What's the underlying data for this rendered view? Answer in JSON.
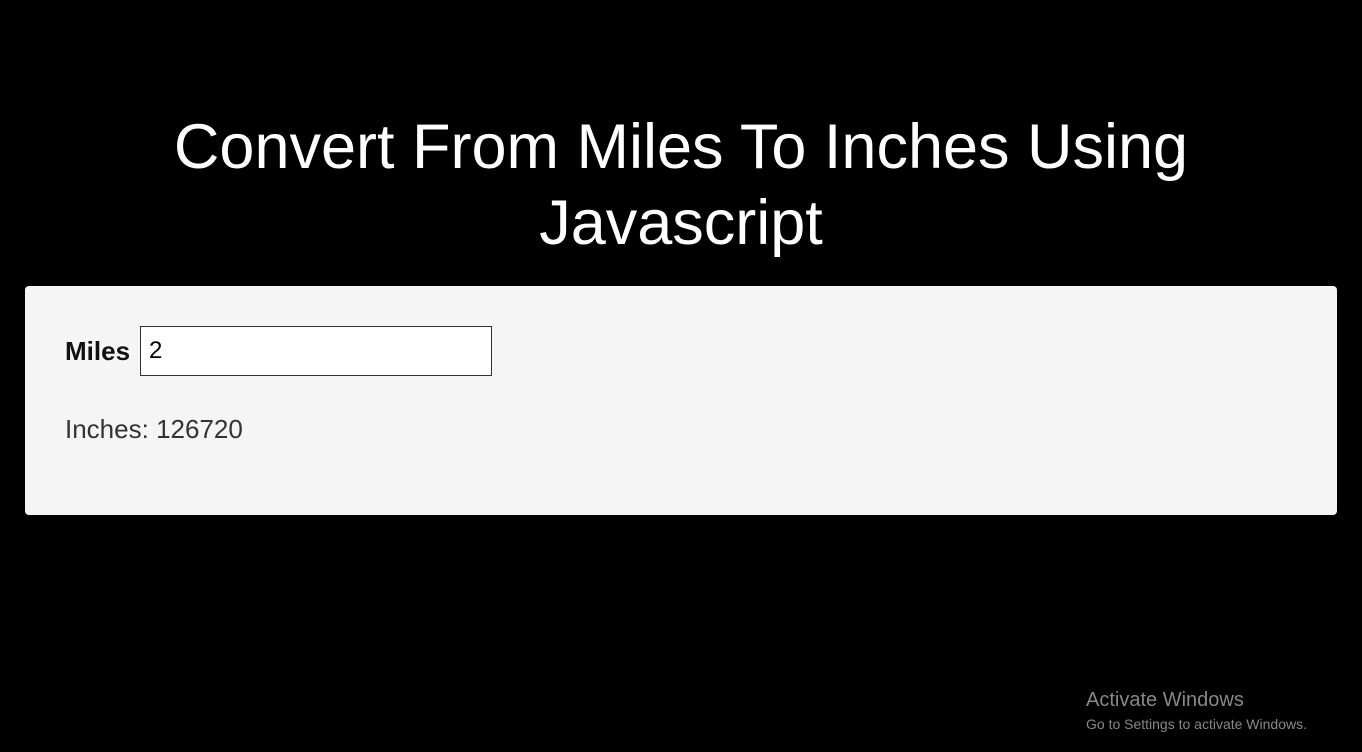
{
  "heading": "Convert From Miles To Inches Using Javascript",
  "form": {
    "miles_label": "Miles",
    "miles_value": "2",
    "output_label": "Inches:",
    "output_value": "126720"
  },
  "watermark": {
    "title": "Activate Windows",
    "subtitle": "Go to Settings to activate Windows."
  }
}
